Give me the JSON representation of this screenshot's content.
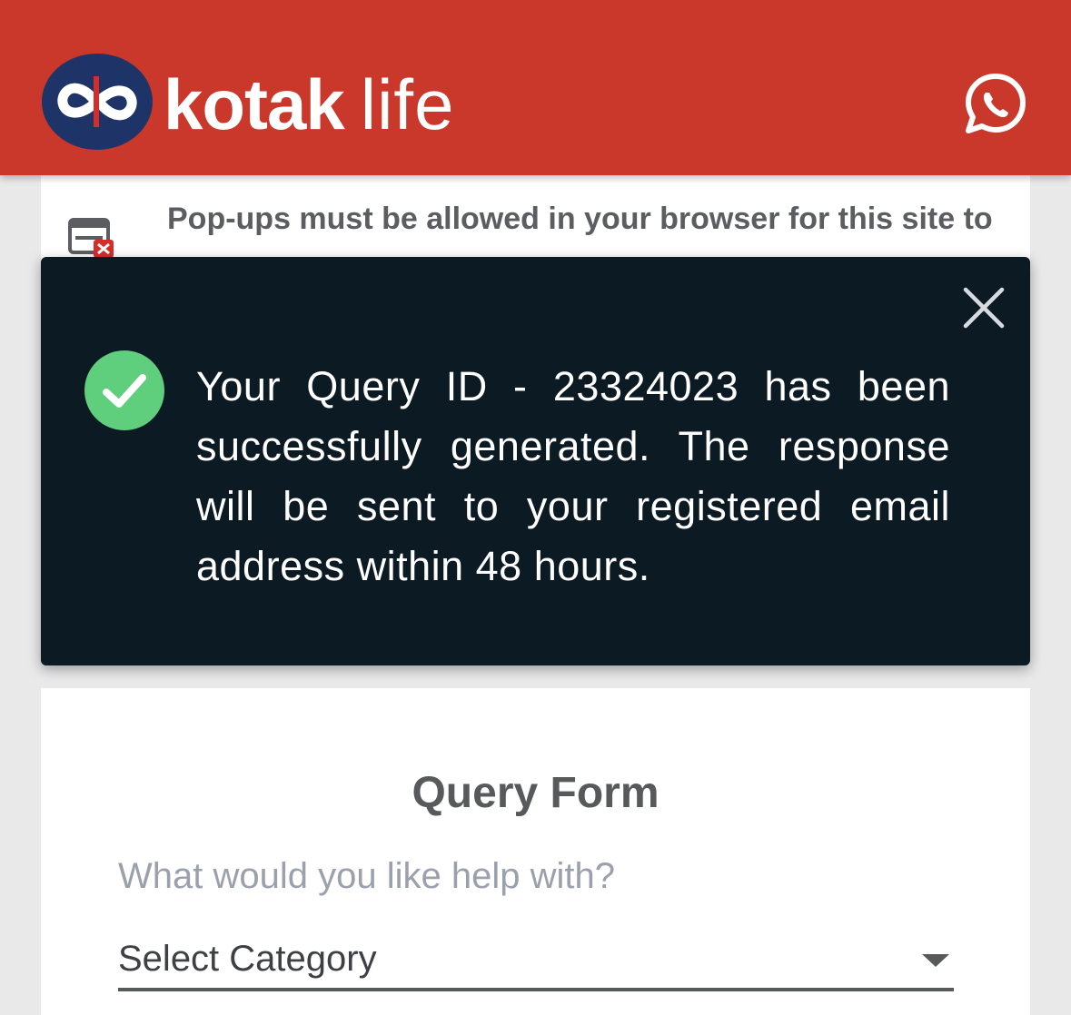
{
  "header": {
    "brand_bold": "kotak",
    "brand_light": "life",
    "logo_icon": "kotak-infinity-logo-icon",
    "whatsapp_icon": "whatsapp-icon",
    "background_color": "#c9382b"
  },
  "notice": {
    "icon": "popup-blocked-icon",
    "text": "Pop-ups must be allowed in your browser for this site to"
  },
  "toast": {
    "message": "Your Query ID - 23324023 has been successfully generated. The response will be sent to your registered email address within 48 hours.",
    "status_icon": "check-circle-icon",
    "status_color": "#5fce7d",
    "close_icon": "close-icon",
    "background_color": "#0c1a24"
  },
  "form": {
    "title": "Query Form",
    "help_label": "What would you like help with?",
    "category_select": {
      "selected_value": "Select Category"
    }
  }
}
